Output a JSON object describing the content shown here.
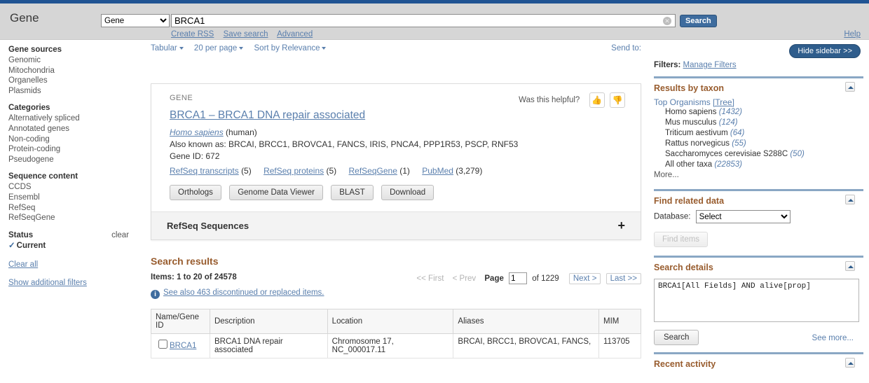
{
  "header": {
    "db_title": "Gene",
    "db_select_value": "Gene",
    "db_options": [
      "Gene"
    ],
    "search_value": "BRCA1",
    "search_placeholder": "",
    "search_button": "Search",
    "clear_icon": "clear-icon",
    "links": [
      "Create RSS",
      "Save search",
      "Advanced"
    ],
    "help": "Help"
  },
  "left_filters": {
    "groups": [
      {
        "title": "Gene sources",
        "items": [
          "Genomic",
          "Mitochondria",
          "Organelles",
          "Plasmids"
        ]
      },
      {
        "title": "Categories",
        "items": [
          "Alternatively spliced",
          "Annotated genes",
          "Non-coding",
          "Protein-coding",
          "Pseudogene"
        ]
      },
      {
        "title": "Sequence content",
        "items": [
          "CCDS",
          "Ensembl",
          "RefSeq",
          "RefSeqGene"
        ]
      }
    ],
    "status": {
      "title": "Status",
      "clear": "clear",
      "items": [
        "Current"
      ],
      "checked": "Current"
    },
    "clear_all": "Clear all",
    "show_additional": "Show additional filters"
  },
  "toolbar": {
    "display": "Tabular",
    "per_page": "20 per page",
    "sort": "Sort by Relevance",
    "send_to": "Send to:"
  },
  "gene_card": {
    "kind": "GENE",
    "helpful_label": "Was this helpful?",
    "thumb_up": "thumbs-up-icon",
    "thumb_down": "thumbs-down-icon",
    "title": "BRCA1  –  BRCA1 DNA repair associated",
    "species_link": "Homo sapiens",
    "species_common": " (human)",
    "also_known_label": "Also known as:",
    "also_known": " BRCAI, BRCC1, BROVCA1, FANCS, IRIS, PNCA4, PPP1R53, PSCP, RNF53",
    "gene_id": "Gene ID: 672",
    "ref_links": [
      {
        "label": "RefSeq transcripts",
        "count": "(5)"
      },
      {
        "label": "RefSeq proteins",
        "count": "(5)"
      },
      {
        "label": "RefSeqGene",
        "count": "(1)"
      },
      {
        "label": "PubMed",
        "count": "(3,279)"
      }
    ],
    "buttons": [
      "Orthologs",
      "Genome Data Viewer",
      "BLAST",
      "Download"
    ],
    "refseq_section": "RefSeq Sequences",
    "refseq_expand": "+"
  },
  "results": {
    "title": "Search results",
    "items_count": "Items: 1 to 20 of 24578",
    "pager": {
      "first": "<< First",
      "prev": "< Prev",
      "page_label": "Page",
      "page_value": "1",
      "of": "of 1229",
      "next": "Next >",
      "last": "Last >>"
    },
    "discontinued": "See also 463 discontinued or replaced items.",
    "table": {
      "columns": [
        "Name/Gene ID",
        "Description",
        "Location",
        "Aliases",
        "MIM"
      ],
      "rows": [
        {
          "name": "BRCA1",
          "description": "BRCA1 DNA repair associated",
          "location": "Chromosome 17, NC_000017.11",
          "aliases": "BRCAI, BRCC1, BROVCA1, FANCS,",
          "mim": "113705"
        }
      ]
    }
  },
  "right": {
    "hide_sidebar": "Hide sidebar >>",
    "filters_label": "Filters:",
    "manage_filters": "Manage Filters",
    "taxon": {
      "title": "Results by taxon",
      "top_organisms": "Top Organisms",
      "tree": "[Tree]",
      "items": [
        {
          "name": "Homo sapiens",
          "count": "(1432)"
        },
        {
          "name": "Mus musculus",
          "count": "(124)"
        },
        {
          "name": "Triticum aestivum",
          "count": "(64)"
        },
        {
          "name": "Rattus norvegicus",
          "count": "(55)"
        },
        {
          "name": "Saccharomyces cerevisiae S288C",
          "count": "(50)"
        },
        {
          "name": "All other taxa",
          "count": "(22853)"
        }
      ],
      "more": "More..."
    },
    "related": {
      "title": "Find related data",
      "database_label": "Database:",
      "select_value": "Select",
      "options": [
        "Select"
      ],
      "find_items": "Find items"
    },
    "details": {
      "title": "Search details",
      "query": "BRCA1[All Fields] AND alive[prop]",
      "search_button": "Search",
      "see_more": "See more..."
    },
    "recent": {
      "title": "Recent activity"
    }
  }
}
